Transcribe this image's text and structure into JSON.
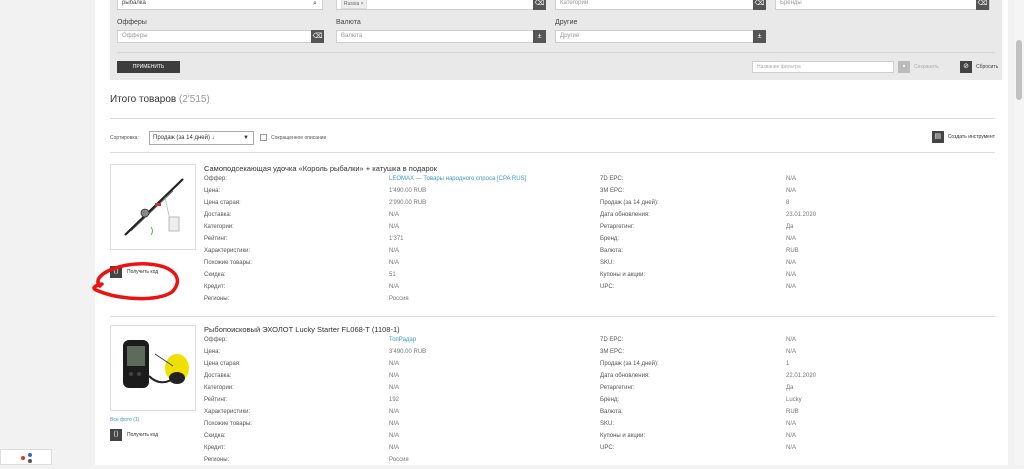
{
  "filters": {
    "search_value": "рыбалка",
    "region_tag": "Russia",
    "categories_placeholder": "Категории",
    "brands_placeholder": "Бренды",
    "offers_label": "Офферы",
    "offers_placeholder": "Офферы",
    "currency_label": "Валюта",
    "currency_placeholder": "Валюта",
    "other_label": "Другие",
    "other_placeholder": "Другие",
    "apply_label": "ПРИМЕНИТЬ",
    "filter_name_placeholder": "Название фильтра",
    "save_label": "Сохранить",
    "reset_label": "Сбросить"
  },
  "summary": {
    "title": "Итого товаров",
    "count": "(2'515)"
  },
  "sort": {
    "label": "Сортировка:",
    "selected": "Продаж (за 14 дней) ↓",
    "short_desc_label": "Сокращенное описание",
    "create_tool_label": "Создать инструмент"
  },
  "products": [
    {
      "title": "Самоподсекающая удочка «Король рыбалки» + катушка в подарок",
      "get_code": "Получить код",
      "rows": [
        {
          "k1": "Оффер:",
          "v1": "LEOMAX — Товары народного спроса [CPA RUS]",
          "k2": "7D EPC:",
          "v2": "N/A"
        },
        {
          "k1": "Цена:",
          "v1": "1'490.00 RUB",
          "k2": "3M EPC:",
          "v2": "N/A"
        },
        {
          "k1": "Цена старая:",
          "v1": "2'990.00 RUB",
          "k2": "Продаж (за 14 дней):",
          "v2": "8"
        },
        {
          "k1": "Доставка:",
          "v1": "N/A",
          "k2": "Дата обновления:",
          "v2": "23.01.2020"
        },
        {
          "k1": "Категории:",
          "v1": "N/A",
          "k2": "Ретаргетинг:",
          "v2": "Да"
        },
        {
          "k1": "Рейтинг:",
          "v1": "1'371",
          "k2": "Бренд:",
          "v2": "N/A"
        },
        {
          "k1": "Характеристики:",
          "v1": "N/A",
          "k2": "Валюта:",
          "v2": "RUB"
        },
        {
          "k1": "Похожие товары:",
          "v1": "N/A",
          "k2": "SKU:",
          "v2": "N/A"
        },
        {
          "k1": "Скидка:",
          "v1": "51",
          "k2": "Купоны и акции:",
          "v2": "N/A"
        },
        {
          "k1": "Кредит:",
          "v1": "N/A",
          "k2": "UPC:",
          "v2": "N/A"
        },
        {
          "k1": "Регионы:",
          "v1": "Россия",
          "k2": "",
          "v2": ""
        }
      ]
    },
    {
      "title": "Рыбопоисковый ЭХОЛОТ Lucky Starter FL068-T (1108-1)",
      "all_photos": "Все фото (1)",
      "get_code": "Получить код",
      "rows": [
        {
          "k1": "Оффер:",
          "v1": "ТопРадар",
          "k2": "7D EPC:",
          "v2": "N/A"
        },
        {
          "k1": "Цена:",
          "v1": "3'490.00 RUB",
          "k2": "3M EPC:",
          "v2": "N/A"
        },
        {
          "k1": "Цена старая:",
          "v1": "N/A",
          "k2": "Продаж (за 14 дней):",
          "v2": "1"
        },
        {
          "k1": "Доставка:",
          "v1": "N/A",
          "k2": "Дата обновления:",
          "v2": "22.01.2020"
        },
        {
          "k1": "Категории:",
          "v1": "N/A",
          "k2": "Ретаргетинг:",
          "v2": "Да"
        },
        {
          "k1": "Рейтинг:",
          "v1": "192",
          "k2": "Бренд:",
          "v2": "Lucky"
        },
        {
          "k1": "Характеристики:",
          "v1": "N/A",
          "k2": "Валюта:",
          "v2": "RUB"
        },
        {
          "k1": "Похожие товары:",
          "v1": "N/A",
          "k2": "SKU:",
          "v2": "N/A"
        },
        {
          "k1": "Скидка:",
          "v1": "N/A",
          "k2": "Купоны и акции:",
          "v2": "N/A"
        },
        {
          "k1": "Кредит:",
          "v1": "N/A",
          "k2": "UPC:",
          "v2": "N/A"
        },
        {
          "k1": "Регионы:",
          "v1": "Россия",
          "k2": "",
          "v2": ""
        }
      ]
    }
  ],
  "colors": {
    "link": "#3b9ac9",
    "annotation": "#ee1111",
    "panel": "#e9e9e9"
  }
}
